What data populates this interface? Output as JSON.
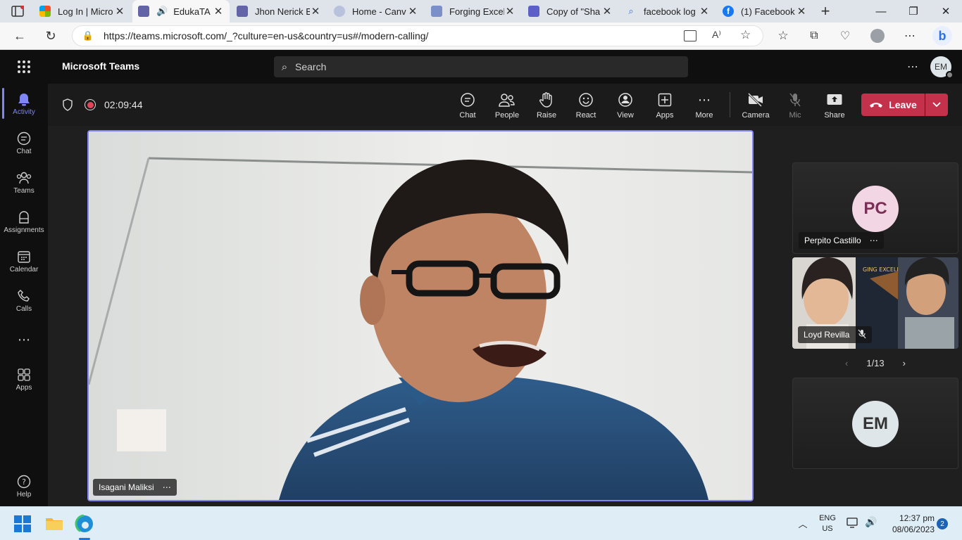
{
  "browser": {
    "tabs": [
      {
        "title": "Log In | Micro",
        "favicon_color": "#888888",
        "active": false
      },
      {
        "title": "EdukaTA",
        "favicon_color": "#6264a7",
        "active": true
      },
      {
        "title": "Jhon Nerick B",
        "favicon_color": "#6264a7",
        "active": false
      },
      {
        "title": "Home - Canv",
        "favicon_color": "#9aa6c7",
        "active": false
      },
      {
        "title": "Forging Excel",
        "favicon_color": "#7b8fc9",
        "active": false
      },
      {
        "title": "Copy of \"Sha",
        "favicon_color": "#5b5fc7",
        "active": false
      },
      {
        "title": "facebook log",
        "favicon_color": "#ffffff",
        "active": false
      },
      {
        "title": "(1) Facebook",
        "favicon_color": "#1877f2",
        "active": false
      }
    ],
    "url": "https://teams.microsoft.com/_?culture=en-us&country=us#/modern-calling/"
  },
  "teams": {
    "app_name": "Microsoft Teams",
    "search_placeholder": "Search",
    "user_initials": "EM",
    "rail": [
      {
        "label": "Activity",
        "icon": "bell-icon",
        "active": true
      },
      {
        "label": "Chat",
        "icon": "chat-icon"
      },
      {
        "label": "Teams",
        "icon": "teams-icon"
      },
      {
        "label": "Assignments",
        "icon": "assignments-icon"
      },
      {
        "label": "Calendar",
        "icon": "calendar-icon"
      },
      {
        "label": "Calls",
        "icon": "phone-icon"
      },
      {
        "label": "Apps",
        "icon": "apps-icon"
      },
      {
        "label": "Help",
        "icon": "help-icon"
      }
    ],
    "call": {
      "timer": "02:09:44",
      "controls": [
        {
          "label": "Chat",
          "icon": "chat-icon"
        },
        {
          "label": "People",
          "icon": "people-icon"
        },
        {
          "label": "Raise",
          "icon": "raise-hand-icon"
        },
        {
          "label": "React",
          "icon": "react-icon"
        },
        {
          "label": "View",
          "icon": "view-icon"
        },
        {
          "label": "Apps",
          "icon": "apps-plus-icon"
        },
        {
          "label": "More",
          "icon": "more-icon"
        },
        {
          "label": "Camera",
          "icon": "camera-off-icon"
        },
        {
          "label": "Mic",
          "icon": "mic-off-icon"
        },
        {
          "label": "Share",
          "icon": "share-icon"
        }
      ],
      "leave_label": "Leave",
      "leave_color": "#c4314b",
      "main_speaker": "Isagani Maliksi",
      "participants": [
        {
          "name": "Perpito Castillo",
          "initials": "PC"
        },
        {
          "name": "Loyd Revilla"
        },
        {
          "initials": "EM"
        }
      ],
      "pagination": "1/13"
    }
  },
  "taskbar": {
    "lang": "ENG",
    "region": "US",
    "time": "12:37 pm",
    "date": "08/06/2023",
    "notification_count": "2"
  }
}
